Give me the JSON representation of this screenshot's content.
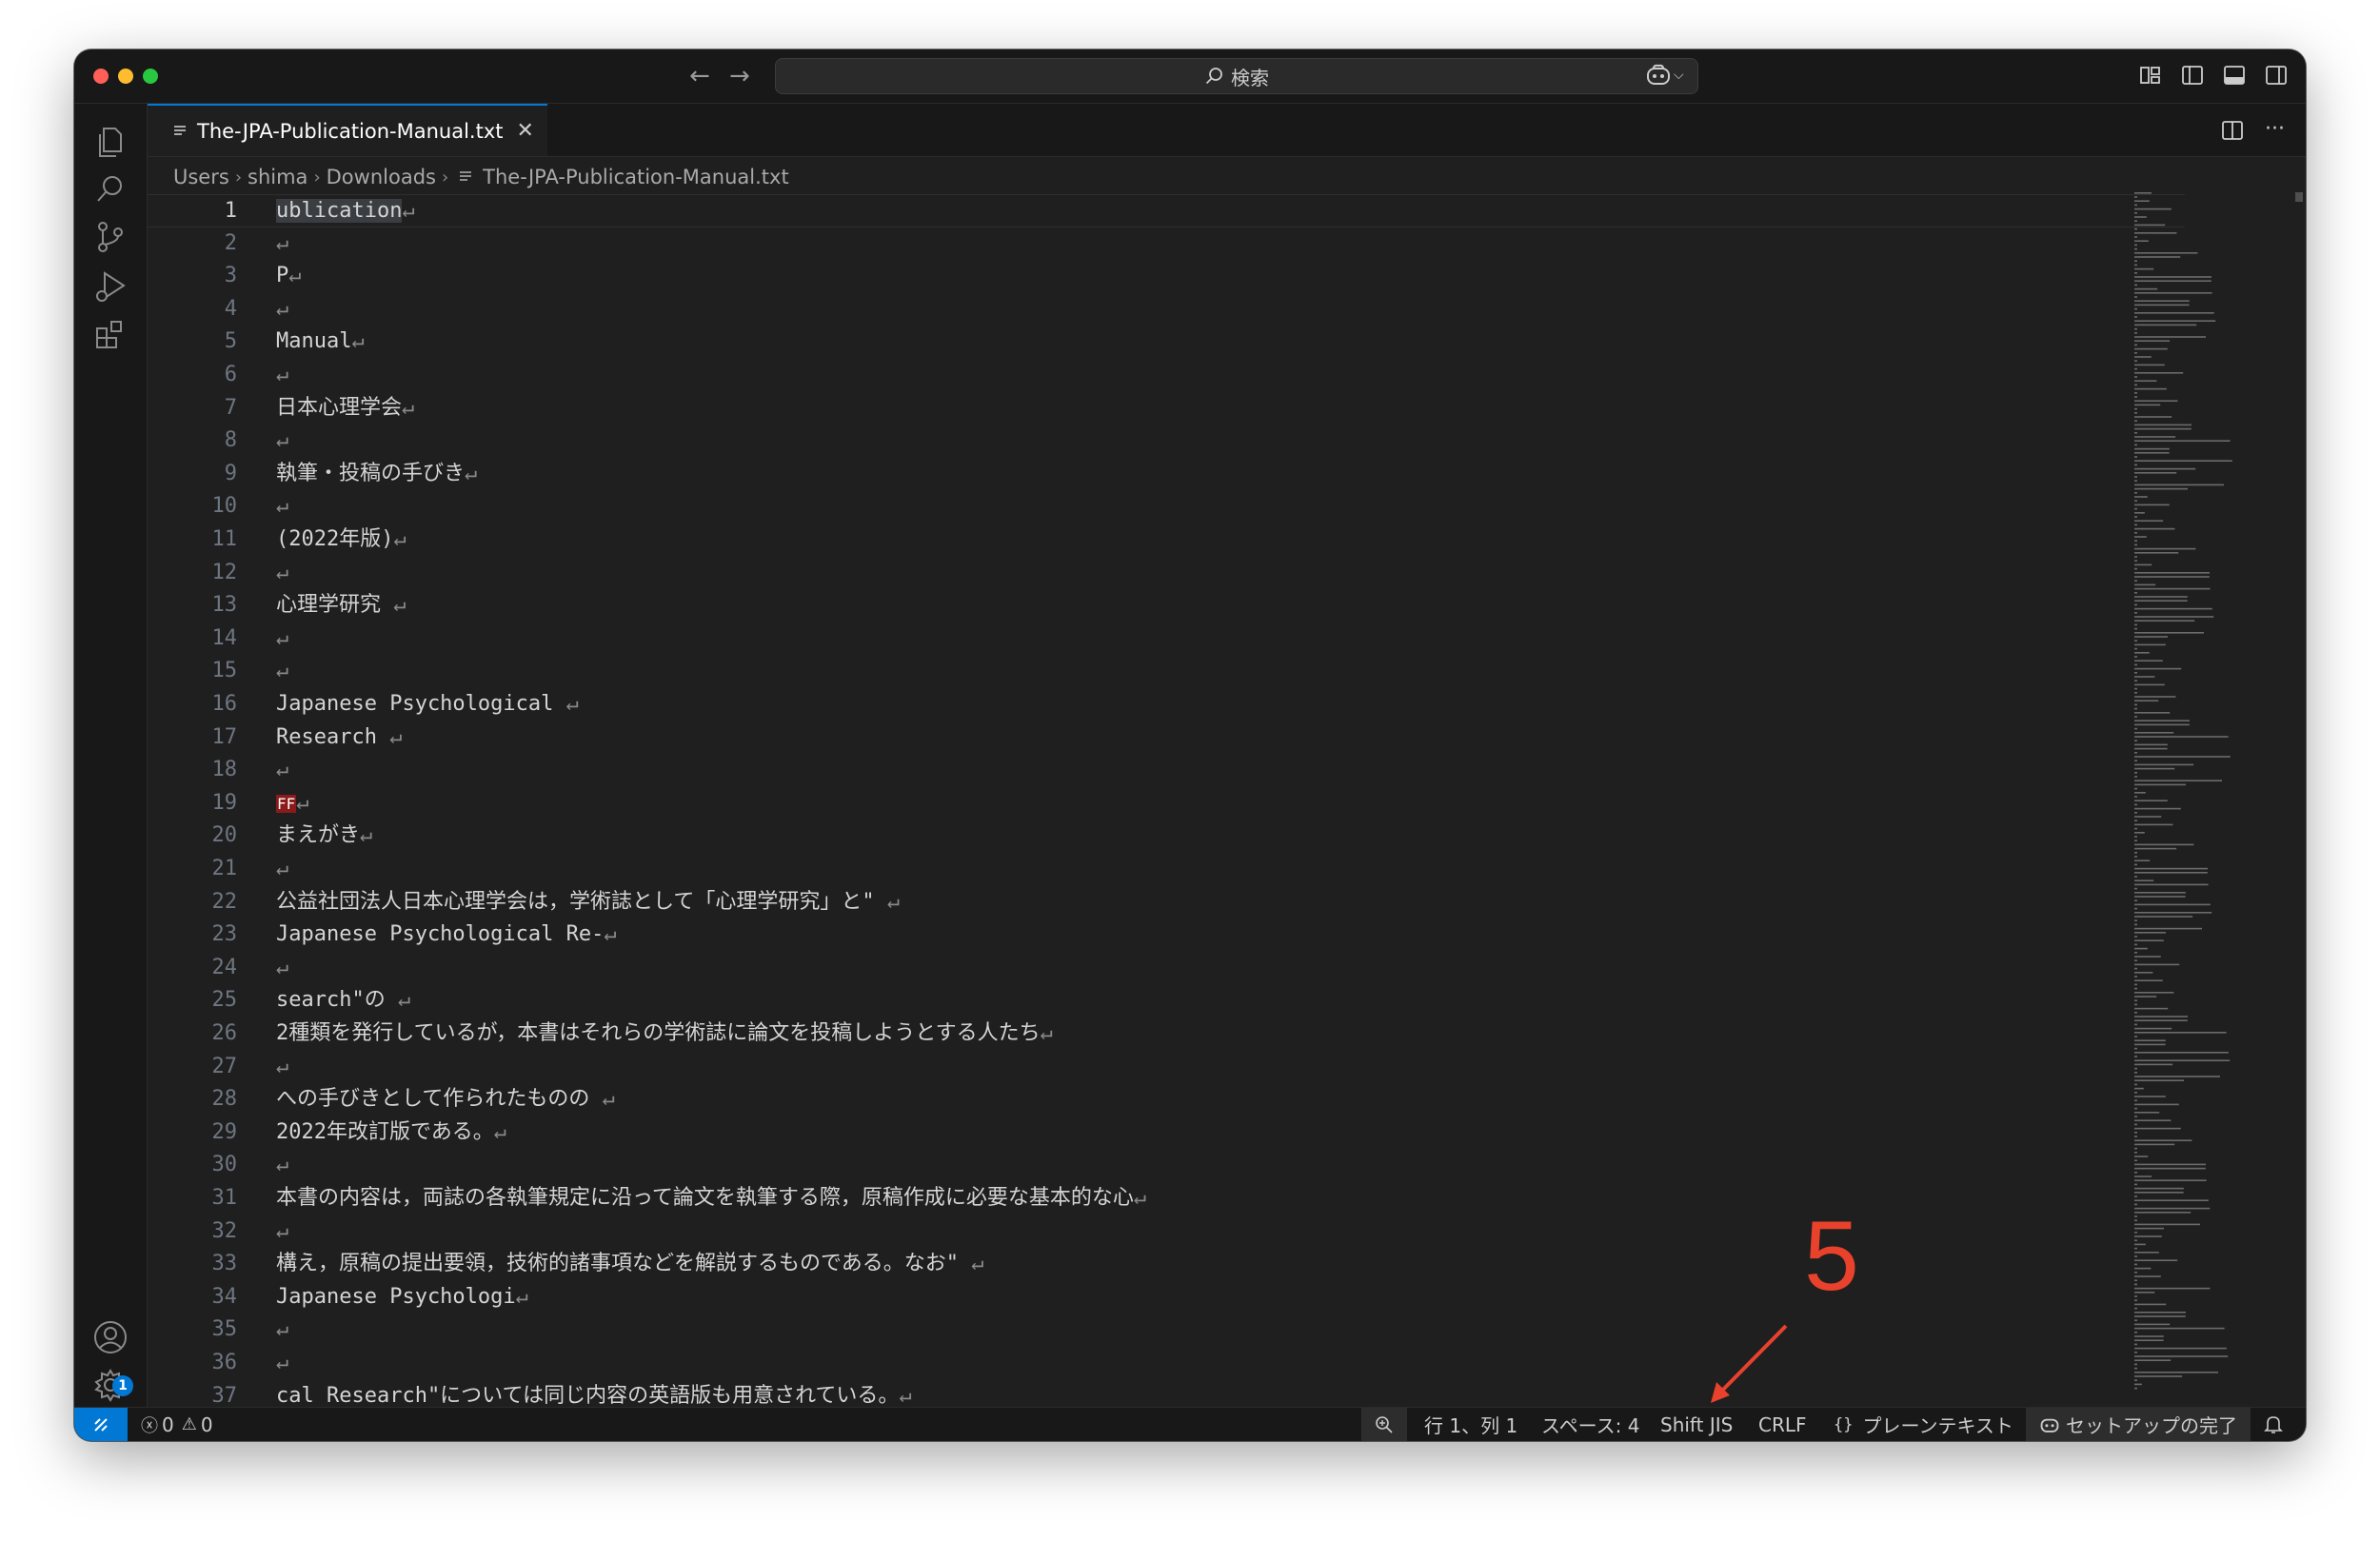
{
  "search": {
    "label": "検索"
  },
  "tab": {
    "filename": "The-JPA-Publication-Manual.txt"
  },
  "breadcrumb": [
    "Users",
    "shima",
    "Downloads",
    "The-JPA-Publication-Manual.txt"
  ],
  "settings_badge": "1",
  "editor": {
    "lines": [
      {
        "n": "1",
        "pre": "",
        "hl": "ublication",
        "text": "",
        "eol": "↵"
      },
      {
        "n": "2",
        "text": "",
        "eol": "↵"
      },
      {
        "n": "3",
        "text": "P",
        "eol": "↵"
      },
      {
        "n": "4",
        "text": "",
        "eol": "↵"
      },
      {
        "n": "5",
        "text": "Manual",
        "eol": "↵"
      },
      {
        "n": "6",
        "text": "",
        "eol": "↵"
      },
      {
        "n": "7",
        "text": "日本心理学会",
        "eol": "↵"
      },
      {
        "n": "8",
        "text": "",
        "eol": "↵"
      },
      {
        "n": "9",
        "text": "執筆・投稿の手びき",
        "eol": "↵"
      },
      {
        "n": "10",
        "text": "",
        "eol": "↵"
      },
      {
        "n": "11",
        "text": "(2022年版)",
        "eol": "↵"
      },
      {
        "n": "12",
        "text": "",
        "eol": "↵"
      },
      {
        "n": "13",
        "text": "心理学研究 ",
        "eol": "↵"
      },
      {
        "n": "14",
        "text": "",
        "eol": "↵"
      },
      {
        "n": "15",
        "text": "",
        "eol": "↵"
      },
      {
        "n": "16",
        "text": "Japanese Psychological ",
        "eol": "↵"
      },
      {
        "n": "17",
        "text": "Research ",
        "eol": "↵"
      },
      {
        "n": "18",
        "text": "",
        "eol": "↵"
      },
      {
        "n": "19",
        "ctrl": "FF",
        "text": "",
        "eol": "↵"
      },
      {
        "n": "20",
        "text": "まえがき",
        "eol": "↵"
      },
      {
        "n": "21",
        "text": "",
        "eol": "↵"
      },
      {
        "n": "22",
        "text": "公益社団法人日本心理学会は，学術誌として「心理学研究」と\" ",
        "eol": "↵"
      },
      {
        "n": "23",
        "text": "Japanese Psychological Re-",
        "eol": "↵"
      },
      {
        "n": "24",
        "text": "",
        "eol": "↵"
      },
      {
        "n": "25",
        "text": "search\"の ",
        "eol": "↵"
      },
      {
        "n": "26",
        "text": "2種類を発行しているが，本書はそれらの学術誌に論文を投稿しようとする人たち",
        "eol": "↵"
      },
      {
        "n": "27",
        "text": "",
        "eol": "↵"
      },
      {
        "n": "28",
        "text": "への手びきとして作られたものの ",
        "eol": "↵"
      },
      {
        "n": "29",
        "text": "2022年改訂版である。",
        "eol": "↵"
      },
      {
        "n": "30",
        "text": "",
        "eol": "↵"
      },
      {
        "n": "31",
        "text": "本書の内容は，両誌の各執筆規定に沿って論文を執筆する際，原稿作成に必要な基本的な心",
        "eol": "↵"
      },
      {
        "n": "32",
        "text": "",
        "eol": "↵"
      },
      {
        "n": "33",
        "text": "構え，原稿の提出要領，技術的諸事項などを解説するものである。なお\" ",
        "eol": "↵"
      },
      {
        "n": "34",
        "text": "Japanese Psychologi",
        "eol": "↵"
      },
      {
        "n": "35",
        "text": "",
        "eol": "↵"
      },
      {
        "n": "36",
        "text": "",
        "eol": "↵"
      },
      {
        "n": "37",
        "text": "cal Research\"については同じ内容の英語版も用意されている。",
        "eol": "↵"
      }
    ]
  },
  "statusbar": {
    "errors": "0",
    "warnings": "0",
    "position": "行 1、列 1",
    "spaces": "スペース: 4",
    "encoding": "Shift JIS",
    "eol": "CRLF",
    "language_braces": "{}",
    "language": "プレーンテキスト",
    "setup": "セットアップの完了"
  },
  "annotation": {
    "label": "5",
    "color": "#e8412c"
  },
  "colors": {
    "accent": "#0078d4",
    "background": "#1f1f1f",
    "sidebar": "#181818"
  }
}
